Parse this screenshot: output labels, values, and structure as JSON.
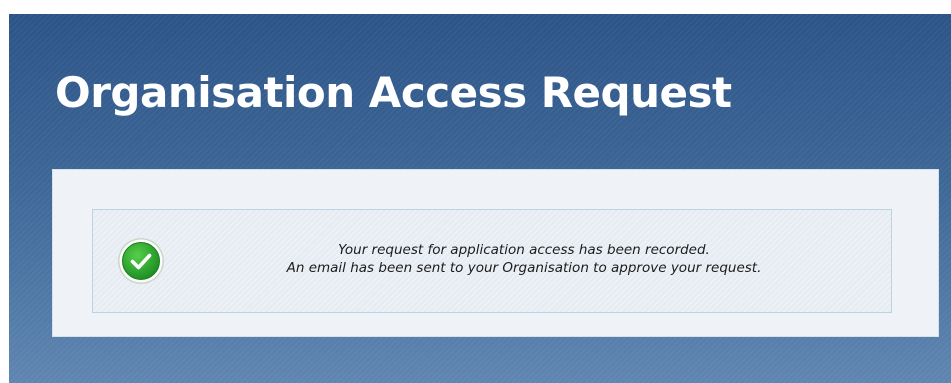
{
  "page": {
    "title": "Organisation Access Request"
  },
  "message": {
    "status_icon": "check-circle-icon",
    "status_color": "#2fa52f",
    "lines": [
      "Your request for application access has been recorded.",
      "An email has been sent to your Organisation to approve your request."
    ]
  }
}
